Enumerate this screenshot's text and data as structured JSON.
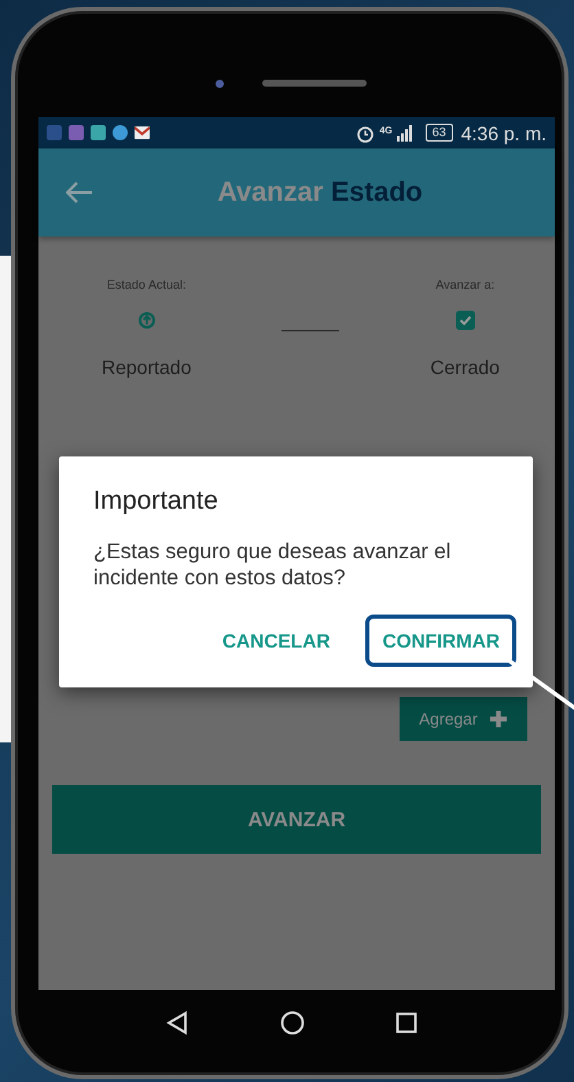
{
  "status_bar": {
    "network": "4G",
    "battery": "63",
    "time": "4:36 p. m."
  },
  "app_bar": {
    "title": "Avanzar",
    "title_accent": "Estado"
  },
  "states": {
    "current_label": "Estado Actual:",
    "current": "Reportado",
    "next_label": "Avanzar a:",
    "next": "Cerrado",
    "next_checked": true
  },
  "add_button": "Agregar",
  "advance_button": "AVANZAR",
  "dialog": {
    "title": "Importante",
    "message": "¿Estas seguro que deseas avanzar el incidente con estos datos?",
    "buttons": [
      {
        "label": "CANCELAR",
        "highlighted": false
      },
      {
        "label": "CONFIRMAR",
        "highlighted": true
      }
    ]
  }
}
